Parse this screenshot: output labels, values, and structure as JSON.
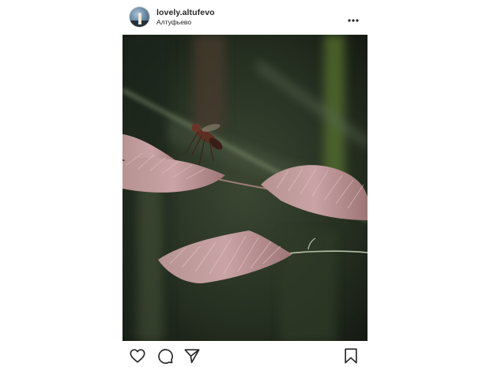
{
  "post": {
    "username": "lovely.altufevo",
    "location": "Алтуфьево"
  },
  "icons": {
    "avatar": "avatar-image",
    "more": "more-options-icon",
    "like": "heart-icon",
    "comment": "comment-icon",
    "share": "share-icon",
    "save": "bookmark-icon"
  },
  "colors": {
    "text": "#262626",
    "background": "#ffffff"
  }
}
